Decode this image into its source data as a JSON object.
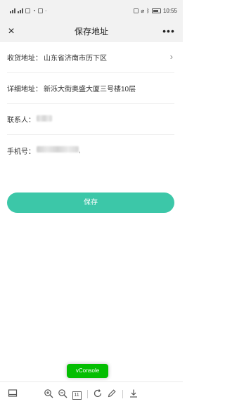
{
  "status_bar": {
    "left_icons": [
      "signal-icon",
      "signal-icon",
      "message-icon",
      "wifi-icon",
      "chat-icon",
      "dot-icon"
    ],
    "right_icons": [
      "nfc-icon",
      "silent-icon",
      "bluetooth-icon",
      "battery-icon"
    ],
    "time": "10:55"
  },
  "navbar": {
    "close_icon": "×",
    "title": "保存地址",
    "more_icon": "•••"
  },
  "form": {
    "region": {
      "label": "收货地址：",
      "value": "山东省济南市历下区",
      "chevron": "›"
    },
    "detail": {
      "label": "详细地址：",
      "value": "新泺大街奥盛大厦三号楼10层"
    },
    "contact": {
      "label": "联系人：",
      "value_obscured": true
    },
    "phone": {
      "label": "手机号：",
      "value_obscured": true,
      "trailing_char": ","
    }
  },
  "save_button": {
    "label": "保存",
    "color": "#3cc7a8"
  },
  "vconsole": {
    "label": "vConsole",
    "color": "#04be02"
  },
  "toolbar": {
    "items": [
      "panel-icon",
      "zoom-in-icon",
      "zoom-out-icon",
      "actual-size-icon",
      "rotate-icon",
      "edit-icon",
      "download-icon"
    ],
    "actual_size_label": "11"
  }
}
